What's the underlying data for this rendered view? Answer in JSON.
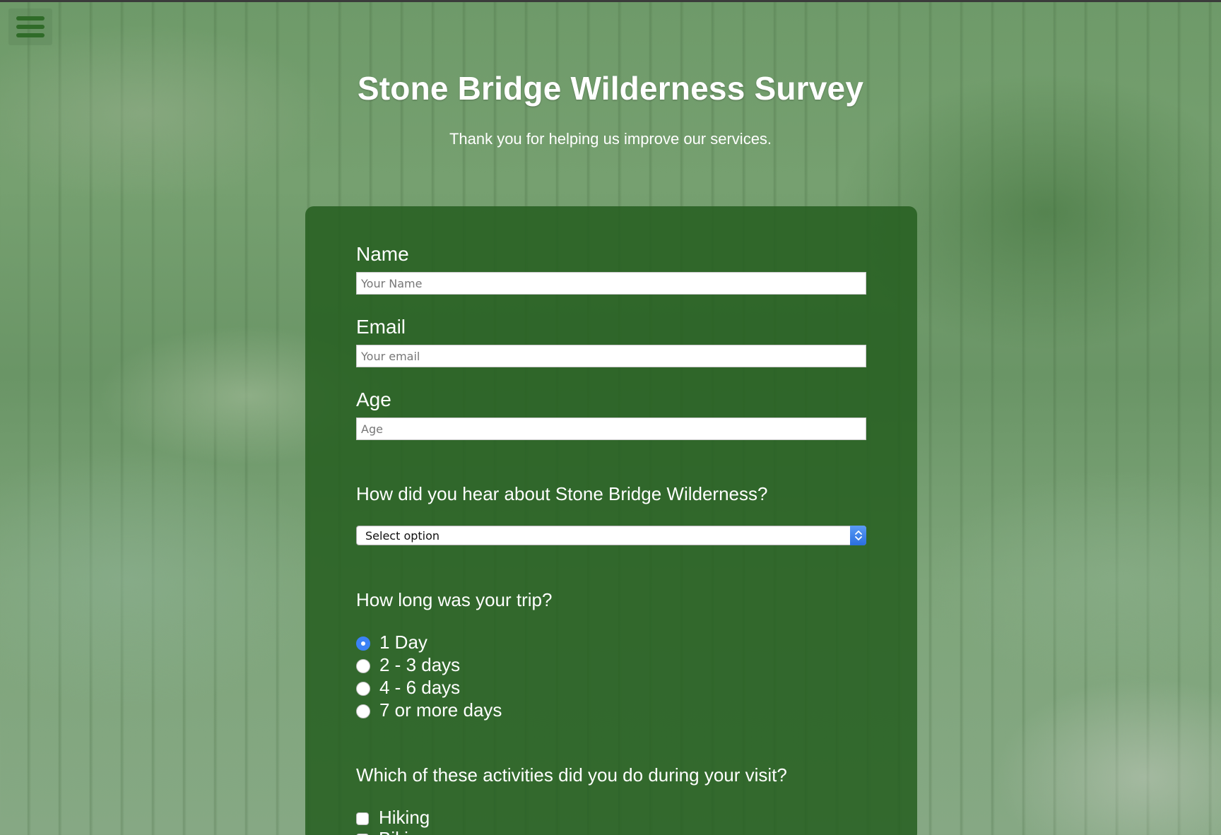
{
  "menu": {
    "icon": "hamburger-menu-icon"
  },
  "header": {
    "title": "Stone Bridge Wilderness Survey",
    "subtitle": "Thank you for helping us improve our services."
  },
  "form": {
    "name": {
      "label": "Name",
      "placeholder": "Your Name",
      "value": ""
    },
    "email": {
      "label": "Email",
      "placeholder": "Your email",
      "value": ""
    },
    "age": {
      "label": "Age",
      "placeholder": "Age",
      "value": ""
    },
    "referral": {
      "question": "How did you hear about Stone Bridge Wilderness?",
      "selected": "Select option"
    },
    "trip": {
      "question": "How long was your trip?",
      "options": [
        {
          "label": "1 Day",
          "checked": true
        },
        {
          "label": "2 - 3 days",
          "checked": false
        },
        {
          "label": "4 - 6 days",
          "checked": false
        },
        {
          "label": "7 or more days",
          "checked": false
        }
      ]
    },
    "activities": {
      "question": "Which of these activities did you do during your visit?",
      "options": [
        {
          "label": "Hiking",
          "checked": false
        },
        {
          "label": "Biking",
          "checked": false
        }
      ]
    }
  },
  "colors": {
    "card": "#255e1f",
    "accent_blue": "#3b82f6",
    "menu_bar": "#2f6b28"
  }
}
